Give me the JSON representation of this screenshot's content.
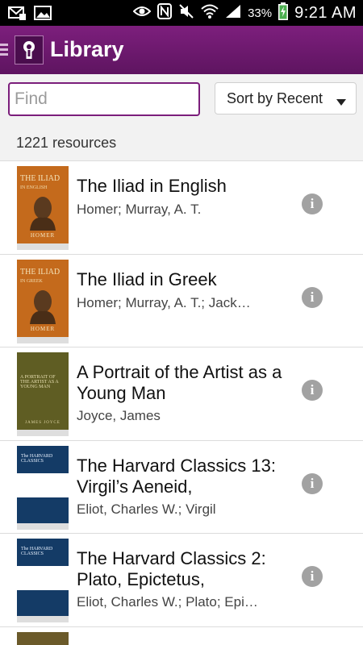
{
  "status_bar": {
    "battery_percent": "33%",
    "time": "9:21 AM"
  },
  "header": {
    "title": "Library"
  },
  "search": {
    "placeholder": "Find",
    "value": ""
  },
  "sort": {
    "selected": "Sort by Recent"
  },
  "resources_count": "1221 resources",
  "items": [
    {
      "title": "The Iliad in English",
      "author": "Homer; Murray, A. T.",
      "cover": {
        "title": "THE ILIAD",
        "subtitle": "IN ENGLISH",
        "author": "HOMER",
        "color": "#c46a1c"
      }
    },
    {
      "title": "The Iliad in Greek",
      "author": "Homer; Murray, A. T.; Jack…",
      "cover": {
        "title": "THE ILIAD",
        "subtitle": "IN GREEK",
        "author": "HOMER",
        "color": "#c46a1c"
      }
    },
    {
      "title": "A Portrait of the Artist as a Young Man",
      "author": "Joyce, James",
      "cover": {
        "title": "A PORTRAIT OF THE ARTIST AS A YOUNG MAN",
        "author": "JAMES JOYCE",
        "color": "#5f5d23"
      }
    },
    {
      "title": "The Harvard Classics 13: Virgil’s Aeneid,",
      "author": "Eliot, Charles W.; Virgil",
      "cover": {
        "title": "The HARVARD CLASSICS",
        "color": "#143b66"
      }
    },
    {
      "title": "The Harvard Classics 2: Plato, Epictetus,",
      "author": "Eliot, Charles W.; Plato; Epi…",
      "cover": {
        "title": "The HARVARD CLASSICS",
        "color": "#143b66"
      }
    }
  ]
}
